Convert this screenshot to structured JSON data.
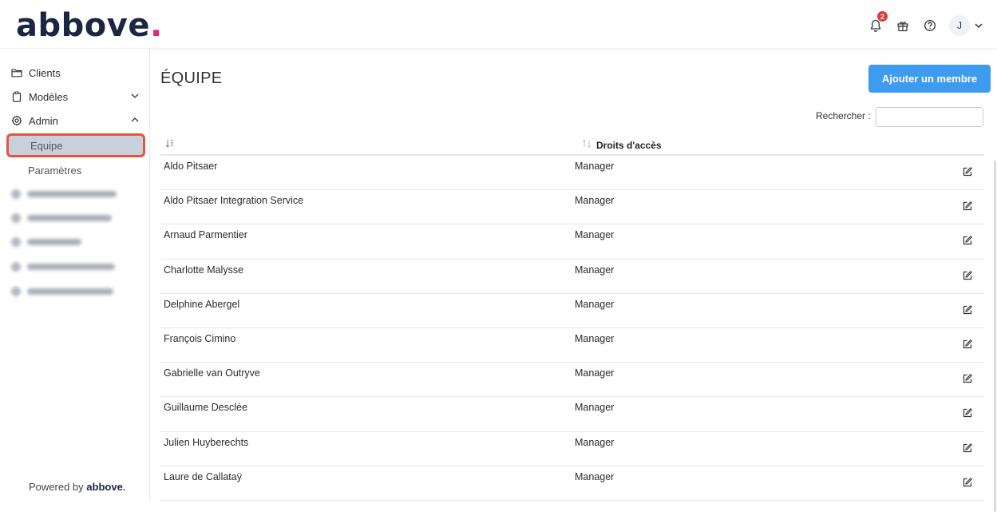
{
  "app": {
    "logo_text": "abbove",
    "logo_dot": "."
  },
  "header": {
    "notifications_count": "2",
    "avatar_initial": "J",
    "icons": [
      "bell-icon",
      "gift-icon",
      "help-icon",
      "chevron-down-icon"
    ]
  },
  "sidebar": {
    "items": [
      {
        "label": "Clients",
        "icon": "folder-icon"
      },
      {
        "label": "Modèles",
        "icon": "clipboard-icon"
      },
      {
        "label": "Admin",
        "icon": "gear-icon"
      }
    ],
    "sub_items": [
      {
        "label": "Equipe",
        "active": true
      },
      {
        "label": "Paramètres",
        "active": false
      }
    ],
    "powered_prefix": "Powered by",
    "powered_brand": "abbove",
    "powered_dot": "."
  },
  "main": {
    "title": "ÉQUIPE",
    "add_button": "Ajouter un membre",
    "search_label": "Rechercher :",
    "search_value": "",
    "columns": {
      "name": "",
      "rights": "Droits d'accès"
    },
    "rows": [
      {
        "name": "Aldo Pitsaer",
        "role": "Manager"
      },
      {
        "name": "Aldo Pitsaer Integration Service",
        "role": "Manager"
      },
      {
        "name": "Arnaud Parmentier",
        "role": "Manager"
      },
      {
        "name": "Charlotte Malysse",
        "role": "Manager"
      },
      {
        "name": "Delphine Abergel",
        "role": "Manager"
      },
      {
        "name": "François Cimino",
        "role": "Manager"
      },
      {
        "name": "Gabrielle van Outryve",
        "role": "Manager"
      },
      {
        "name": "Guillaume Desclée",
        "role": "Manager"
      },
      {
        "name": "Julien Huyberechts",
        "role": "Manager"
      },
      {
        "name": "Laure de Callataÿ",
        "role": "Manager"
      }
    ]
  },
  "colors": {
    "brand": "#1c2541",
    "brand_dot": "#e6247a",
    "primary_button": "#3d9bf0",
    "active_nav_bg": "#c8d0db",
    "highlight_border": "#e0563f",
    "badge": "#e53935"
  }
}
